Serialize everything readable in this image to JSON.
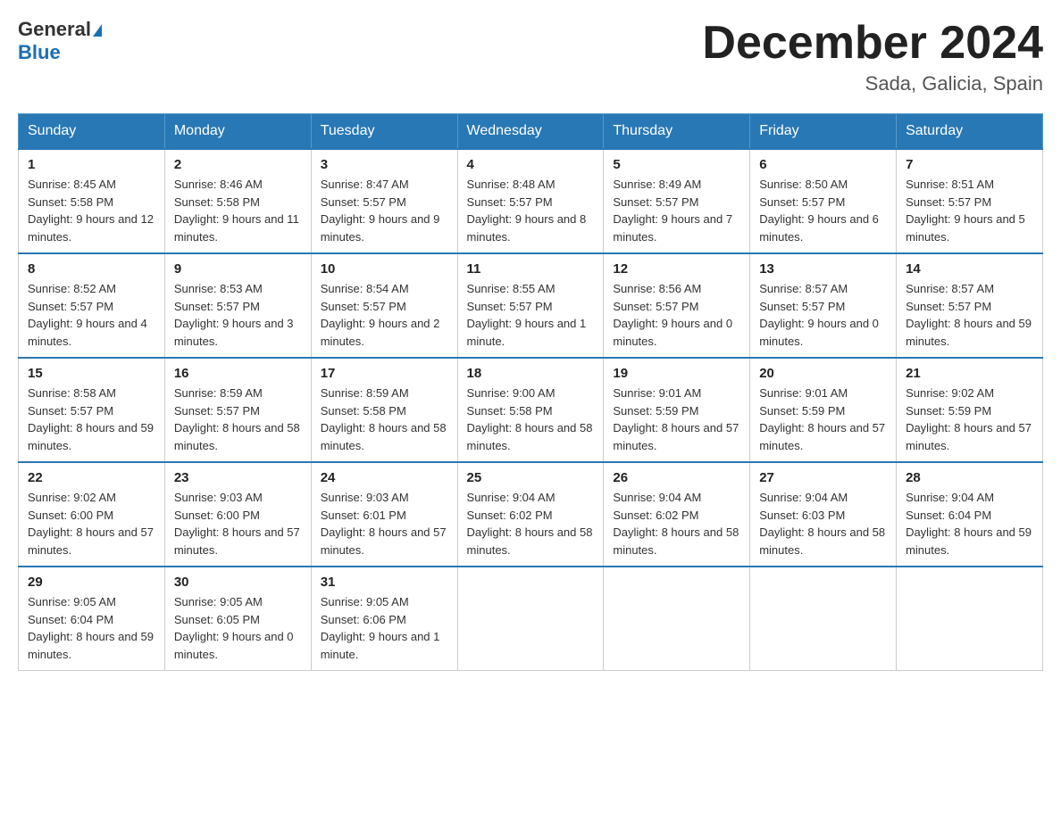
{
  "header": {
    "logo_general": "General",
    "logo_blue": "Blue",
    "month_title": "December 2024",
    "location": "Sada, Galicia, Spain"
  },
  "days_of_week": [
    "Sunday",
    "Monday",
    "Tuesday",
    "Wednesday",
    "Thursday",
    "Friday",
    "Saturday"
  ],
  "weeks": [
    [
      {
        "day": "1",
        "sunrise": "8:45 AM",
        "sunset": "5:58 PM",
        "daylight": "9 hours and 12 minutes."
      },
      {
        "day": "2",
        "sunrise": "8:46 AM",
        "sunset": "5:58 PM",
        "daylight": "9 hours and 11 minutes."
      },
      {
        "day": "3",
        "sunrise": "8:47 AM",
        "sunset": "5:57 PM",
        "daylight": "9 hours and 9 minutes."
      },
      {
        "day": "4",
        "sunrise": "8:48 AM",
        "sunset": "5:57 PM",
        "daylight": "9 hours and 8 minutes."
      },
      {
        "day": "5",
        "sunrise": "8:49 AM",
        "sunset": "5:57 PM",
        "daylight": "9 hours and 7 minutes."
      },
      {
        "day": "6",
        "sunrise": "8:50 AM",
        "sunset": "5:57 PM",
        "daylight": "9 hours and 6 minutes."
      },
      {
        "day": "7",
        "sunrise": "8:51 AM",
        "sunset": "5:57 PM",
        "daylight": "9 hours and 5 minutes."
      }
    ],
    [
      {
        "day": "8",
        "sunrise": "8:52 AM",
        "sunset": "5:57 PM",
        "daylight": "9 hours and 4 minutes."
      },
      {
        "day": "9",
        "sunrise": "8:53 AM",
        "sunset": "5:57 PM",
        "daylight": "9 hours and 3 minutes."
      },
      {
        "day": "10",
        "sunrise": "8:54 AM",
        "sunset": "5:57 PM",
        "daylight": "9 hours and 2 minutes."
      },
      {
        "day": "11",
        "sunrise": "8:55 AM",
        "sunset": "5:57 PM",
        "daylight": "9 hours and 1 minute."
      },
      {
        "day": "12",
        "sunrise": "8:56 AM",
        "sunset": "5:57 PM",
        "daylight": "9 hours and 0 minutes."
      },
      {
        "day": "13",
        "sunrise": "8:57 AM",
        "sunset": "5:57 PM",
        "daylight": "9 hours and 0 minutes."
      },
      {
        "day": "14",
        "sunrise": "8:57 AM",
        "sunset": "5:57 PM",
        "daylight": "8 hours and 59 minutes."
      }
    ],
    [
      {
        "day": "15",
        "sunrise": "8:58 AM",
        "sunset": "5:57 PM",
        "daylight": "8 hours and 59 minutes."
      },
      {
        "day": "16",
        "sunrise": "8:59 AM",
        "sunset": "5:57 PM",
        "daylight": "8 hours and 58 minutes."
      },
      {
        "day": "17",
        "sunrise": "8:59 AM",
        "sunset": "5:58 PM",
        "daylight": "8 hours and 58 minutes."
      },
      {
        "day": "18",
        "sunrise": "9:00 AM",
        "sunset": "5:58 PM",
        "daylight": "8 hours and 58 minutes."
      },
      {
        "day": "19",
        "sunrise": "9:01 AM",
        "sunset": "5:59 PM",
        "daylight": "8 hours and 57 minutes."
      },
      {
        "day": "20",
        "sunrise": "9:01 AM",
        "sunset": "5:59 PM",
        "daylight": "8 hours and 57 minutes."
      },
      {
        "day": "21",
        "sunrise": "9:02 AM",
        "sunset": "5:59 PM",
        "daylight": "8 hours and 57 minutes."
      }
    ],
    [
      {
        "day": "22",
        "sunrise": "9:02 AM",
        "sunset": "6:00 PM",
        "daylight": "8 hours and 57 minutes."
      },
      {
        "day": "23",
        "sunrise": "9:03 AM",
        "sunset": "6:00 PM",
        "daylight": "8 hours and 57 minutes."
      },
      {
        "day": "24",
        "sunrise": "9:03 AM",
        "sunset": "6:01 PM",
        "daylight": "8 hours and 57 minutes."
      },
      {
        "day": "25",
        "sunrise": "9:04 AM",
        "sunset": "6:02 PM",
        "daylight": "8 hours and 58 minutes."
      },
      {
        "day": "26",
        "sunrise": "9:04 AM",
        "sunset": "6:02 PM",
        "daylight": "8 hours and 58 minutes."
      },
      {
        "day": "27",
        "sunrise": "9:04 AM",
        "sunset": "6:03 PM",
        "daylight": "8 hours and 58 minutes."
      },
      {
        "day": "28",
        "sunrise": "9:04 AM",
        "sunset": "6:04 PM",
        "daylight": "8 hours and 59 minutes."
      }
    ],
    [
      {
        "day": "29",
        "sunrise": "9:05 AM",
        "sunset": "6:04 PM",
        "daylight": "8 hours and 59 minutes."
      },
      {
        "day": "30",
        "sunrise": "9:05 AM",
        "sunset": "6:05 PM",
        "daylight": "9 hours and 0 minutes."
      },
      {
        "day": "31",
        "sunrise": "9:05 AM",
        "sunset": "6:06 PM",
        "daylight": "9 hours and 1 minute."
      },
      null,
      null,
      null,
      null
    ]
  ]
}
